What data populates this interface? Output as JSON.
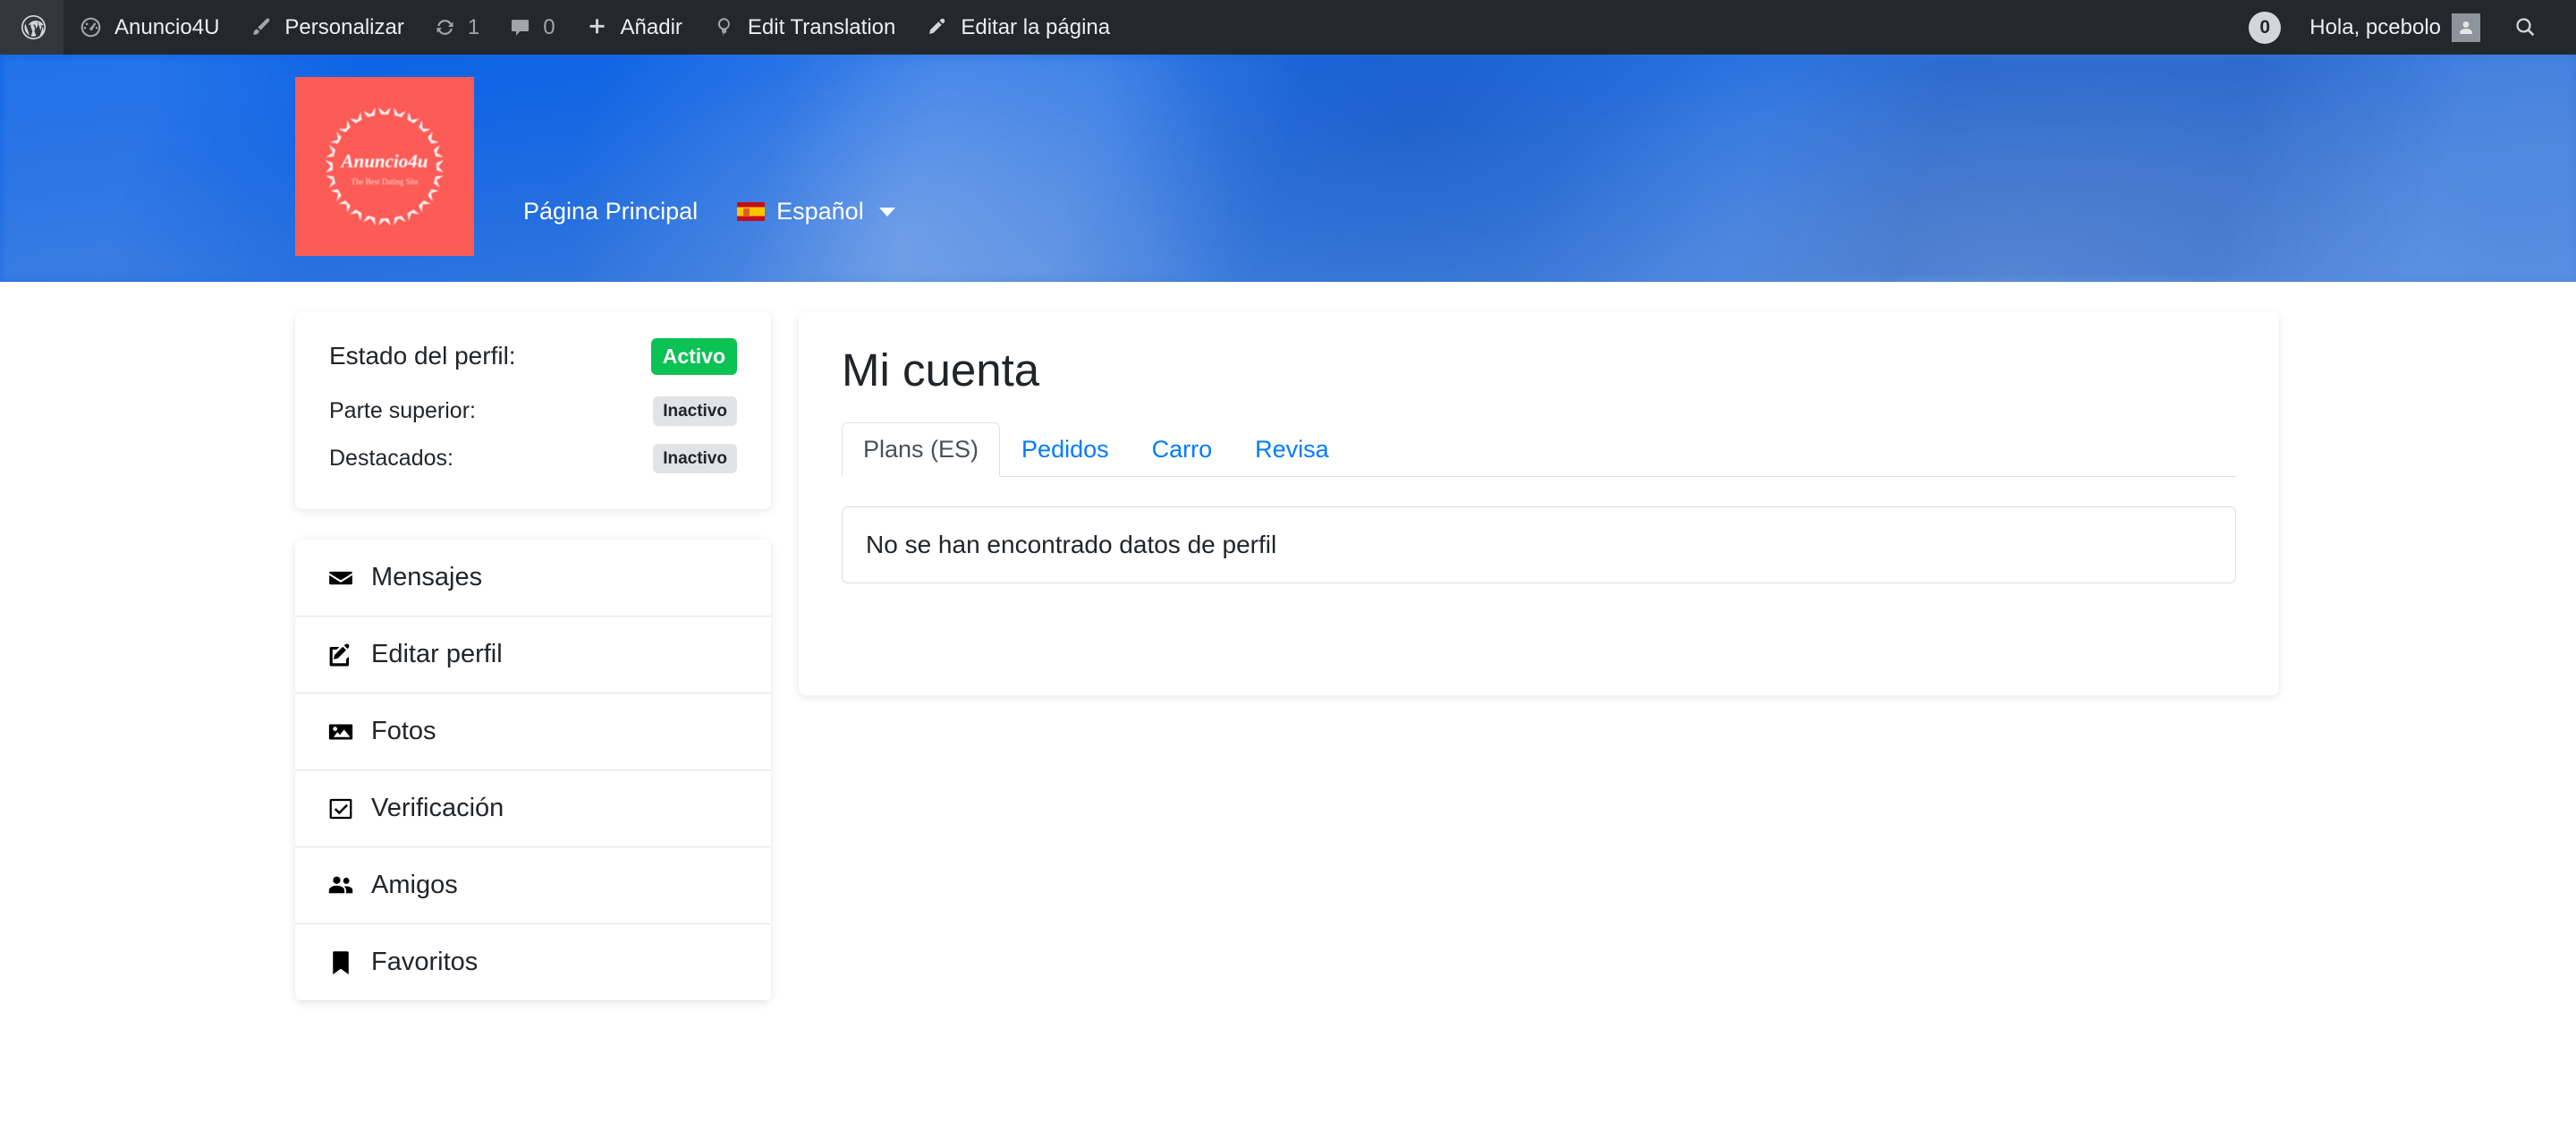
{
  "adminbar": {
    "wp_logo_icon": "wordpress-icon",
    "items": [
      {
        "icon": "dashboard-icon",
        "label": "Anuncio4U"
      },
      {
        "icon": "paintbrush-icon",
        "label": "Personalizar"
      },
      {
        "icon": "updates-icon",
        "label": "1"
      },
      {
        "icon": "comment-icon",
        "label": "0"
      },
      {
        "icon": "plus-icon",
        "label": "Añadir"
      },
      {
        "icon": "translate-icon",
        "label": "Edit Translation"
      },
      {
        "icon": "pencil-icon",
        "label": "Editar la página"
      }
    ],
    "notifications_count": "0",
    "greeting": "Hola, pcebolo",
    "avatar_icon": "user-avatar-icon",
    "search_icon": "search-icon"
  },
  "hero": {
    "logo": {
      "brand": "Anuncio4u",
      "tagline": "The Best Dating Site",
      "background_color": "#fc5b56"
    },
    "nav": {
      "home_label": "Página Principal",
      "language_label": "Español",
      "language_flag_icon": "flag-es-icon",
      "caret_icon": "chevron-down-icon"
    }
  },
  "sidebar": {
    "status": {
      "rows": [
        {
          "label": "Estado del perfil:",
          "badge": "Activo",
          "badge_style": "success",
          "badge_color": "#0bc254"
        },
        {
          "label": "Parte superior:",
          "badge": "Inactivo",
          "badge_style": "muted",
          "badge_color": "#e2e3e5"
        },
        {
          "label": "Destacados:",
          "badge": "Inactivo",
          "badge_style": "muted",
          "badge_color": "#e2e3e5"
        }
      ]
    },
    "menu": [
      {
        "icon": "envelope-icon",
        "label": "Mensajes"
      },
      {
        "icon": "edit-square-icon",
        "label": "Editar perfil"
      },
      {
        "icon": "image-icon",
        "label": "Fotos"
      },
      {
        "icon": "check-square-icon",
        "label": "Verificación"
      },
      {
        "icon": "users-icon",
        "label": "Amigos"
      },
      {
        "icon": "bookmark-icon",
        "label": "Favoritos"
      }
    ]
  },
  "main": {
    "title": "Mi cuenta",
    "tabs": [
      {
        "label": "Plans (ES)",
        "active": true
      },
      {
        "label": "Pedidos",
        "active": false
      },
      {
        "label": "Carro",
        "active": false
      },
      {
        "label": "Revisa",
        "active": false
      }
    ],
    "empty_message": "No se han encontrado datos de perfil",
    "link_color": "#007bff"
  }
}
